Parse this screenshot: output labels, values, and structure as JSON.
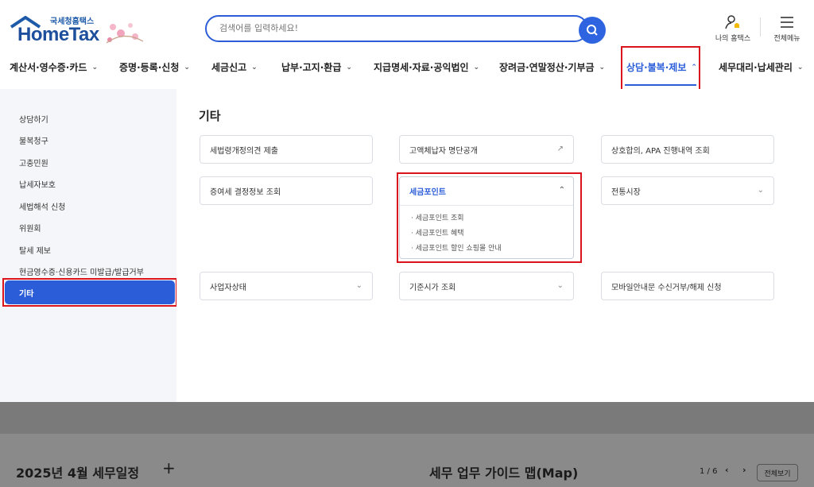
{
  "header": {
    "logo_small": "국세청홈택스",
    "logo_big": "HomeTax",
    "search_placeholder": "검색어를 입력하세요!",
    "my_hometax": "나의 홈택스",
    "all_menu": "전체메뉴"
  },
  "nav": {
    "items": [
      {
        "label": "계산서·영수증·카드"
      },
      {
        "label": "증명·등록·신청"
      },
      {
        "label": "세금신고"
      },
      {
        "label": "납부·고지·환급"
      },
      {
        "label": "지급명세·자료·공익법인"
      },
      {
        "label": "장려금·연말정산·기부금"
      },
      {
        "label": "상담·불복·제보"
      },
      {
        "label": "세무대리·납세관리"
      }
    ]
  },
  "sidebar": {
    "items": [
      {
        "label": "상담하기"
      },
      {
        "label": "불복청구"
      },
      {
        "label": "고충민원"
      },
      {
        "label": "납세자보호"
      },
      {
        "label": "세법해석 신청"
      },
      {
        "label": "위원회"
      },
      {
        "label": "탈세 제보"
      },
      {
        "label": "현금영수증·신용카드 미발급/발급거부"
      },
      {
        "label": "기타"
      }
    ]
  },
  "main": {
    "title": "기타",
    "cards": [
      {
        "label": "세법령개정의견 제출"
      },
      {
        "label": "고액체납자 명단공개"
      },
      {
        "label": "상호합의, APA 진행내역 조회"
      },
      {
        "label": "증여세 결정정보 조회"
      },
      {
        "label": "세금포인트"
      },
      {
        "label": "전통시장"
      },
      {
        "label": "사업자상태"
      },
      {
        "label": "기준시가 조회"
      },
      {
        "label": "모바일안내문 수신거부/해제 신청"
      }
    ],
    "expanded_sub": [
      {
        "label": "세금포인트 조회"
      },
      {
        "label": "세금포인트 혜택"
      },
      {
        "label": "세금포인트 할인 쇼핑몰 안내"
      }
    ]
  },
  "bottom": {
    "schedule": "2025년 4월 세무일정",
    "guide": "세무 업무 가이드 맵(Map)",
    "page": "1 / 6",
    "view_all": "전체보기"
  },
  "colors": {
    "accent": "#2b5dd9",
    "highlight": "#d9141d"
  }
}
